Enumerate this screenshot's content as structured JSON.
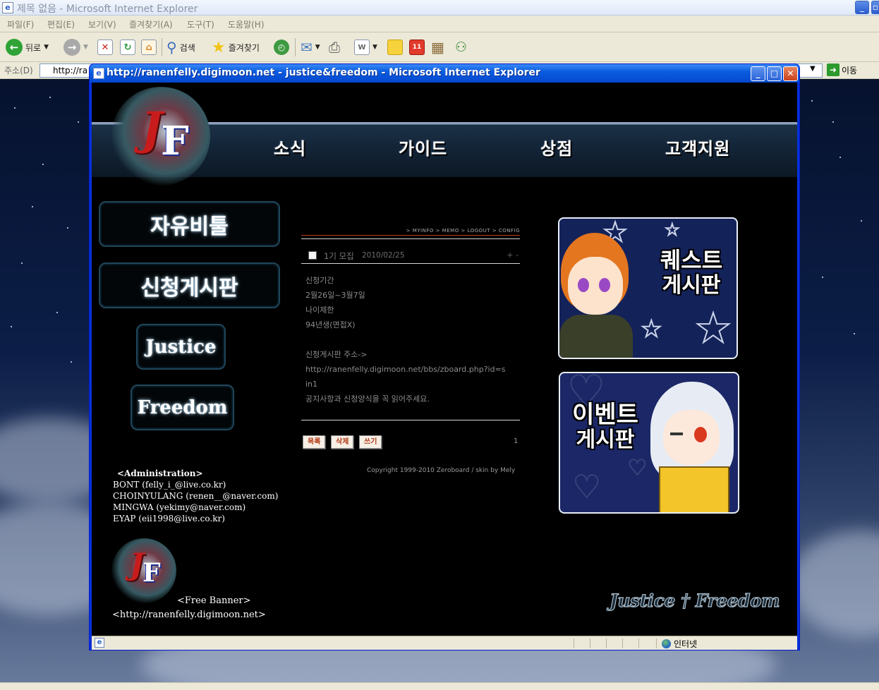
{
  "outer_window": {
    "title": "제목 없음 - Microsoft Internet Explorer",
    "menu": [
      "파일(F)",
      "편집(E)",
      "보기(V)",
      "즐겨찾기(A)",
      "도구(T)",
      "도움말(H)"
    ],
    "toolbar": {
      "back_label": "뒤로",
      "search_label": "검색",
      "favorites_label": "즐겨찾기"
    },
    "address_label": "주소(D)",
    "address_value": "http://ra",
    "go_label": "이동"
  },
  "popup_window": {
    "title": "http://ranenfelly.digimoon.net - justice&freedom - Microsoft Internet Explorer",
    "status_zone": "인터넷"
  },
  "site": {
    "logo_letters": {
      "j": "J",
      "f": "F"
    },
    "nav": [
      "소식",
      "가이드",
      "상점",
      "고객지원"
    ],
    "side_buttons": [
      "자유비툴",
      "신청게시판",
      "Justice",
      "Freedom"
    ],
    "admin": {
      "heading": "<Administration>",
      "members": [
        "BONT (felly_i_@live.co.kr)",
        "CHOINYULANG (renen__@naver.com)",
        "MINGWA (yekimy@naver.com)",
        "EYAP (eii1998@live.co.kr)"
      ]
    },
    "board": {
      "links": "> MYINFO > MEMO > LOGOUT > CONFIG",
      "post_title": "1기 모집",
      "post_date": "2010/02/25",
      "post_controls": "+ -",
      "body_lines": [
        "신청기간",
        "2월26일~3월7일",
        "나이제한",
        "94년생(면접X)",
        "",
        "신청게시판 주소->",
        "http://ranenfelly.digimoon.net/bbs/zboard.php?id=s",
        "in1",
        "공지사항과 신청양식을 꼭 읽어주세요."
      ],
      "buttons": [
        "목록",
        "삭제",
        "쓰기"
      ],
      "page_number": "1",
      "copyright": "Copyright 1999-2010 Zeroboard / skin by Mely"
    },
    "banners": {
      "quest": {
        "line1": "퀘스트",
        "line2": "게시판"
      },
      "event": {
        "line1": "이벤트",
        "line2": "게시판"
      }
    },
    "footer": {
      "free_banner": "<Free Banner>",
      "url": "<http://ranenfelly.digimoon.net>",
      "logo_text": "Justice † Freedom"
    }
  }
}
